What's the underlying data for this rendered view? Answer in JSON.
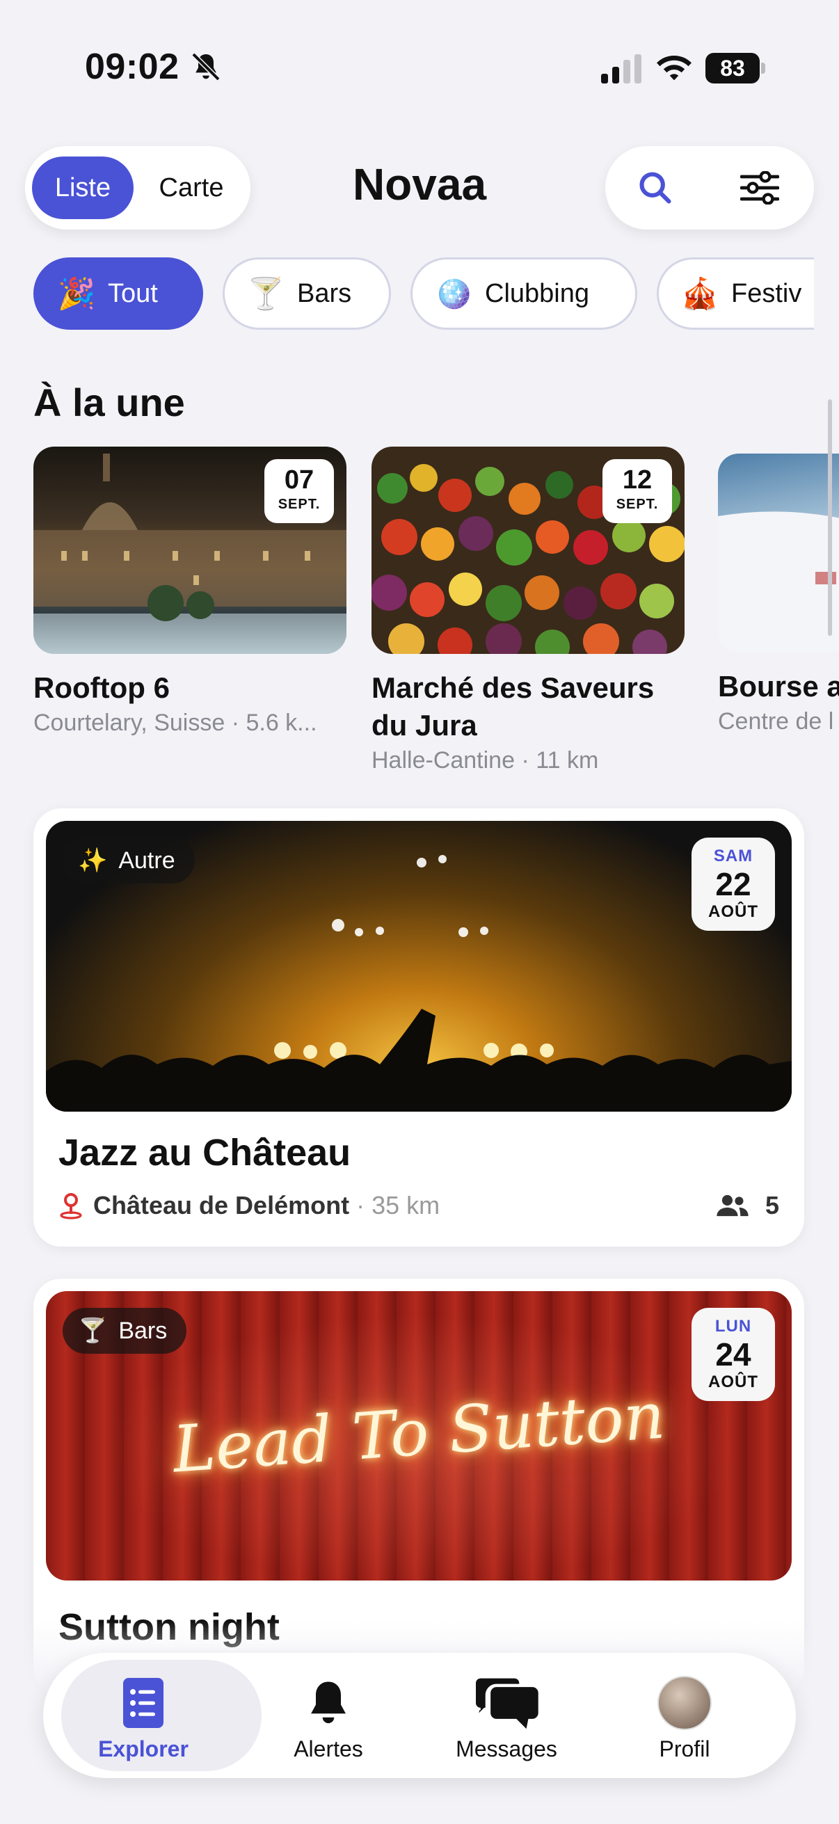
{
  "status_bar": {
    "time": "09:02",
    "battery": "83"
  },
  "header": {
    "segment_list": "Liste",
    "segment_map": "Carte",
    "title": "Novaa"
  },
  "categories": [
    {
      "emoji": "🎉",
      "label": "Tout",
      "active": true
    },
    {
      "emoji": "🍸",
      "label": "Bars",
      "active": false
    },
    {
      "emoji": "🪩",
      "label": "Clubbing",
      "active": false
    },
    {
      "emoji": "🎪",
      "label": "Festiv",
      "active": false
    }
  ],
  "featured_section": {
    "title": "À la une",
    "items": [
      {
        "day": "07",
        "month": "SEPT.",
        "name": "Rooftop 6",
        "meta": "Courtelary, Suisse · 5.6 k..."
      },
      {
        "day": "12",
        "month": "SEPT.",
        "name": "Marché des Saveurs du Jura",
        "meta": "Halle-Cantine · 11 km"
      },
      {
        "day": "",
        "month": "",
        "name": "Bourse a",
        "meta": "Centre de l"
      }
    ]
  },
  "events": [
    {
      "category_emoji": "✨",
      "category": "Autre",
      "weekday": "SAM",
      "day": "22",
      "month": "AOÛT",
      "title": "Jazz au Château",
      "venue": "Château de Delémont",
      "distance": "· 35 km",
      "attendees": "5"
    },
    {
      "category_emoji": "🍸",
      "category": "Bars",
      "weekday": "LUN",
      "day": "24",
      "month": "AOÛT",
      "title": "Sutton night",
      "neon_sign": "Lead To Sutton"
    }
  ],
  "tab_bar": {
    "explorer": "Explorer",
    "alerts": "Alertes",
    "messages": "Messages",
    "profile": "Profil"
  },
  "colors": {
    "accent": "#4a52d6",
    "background": "#f2f2f7"
  }
}
